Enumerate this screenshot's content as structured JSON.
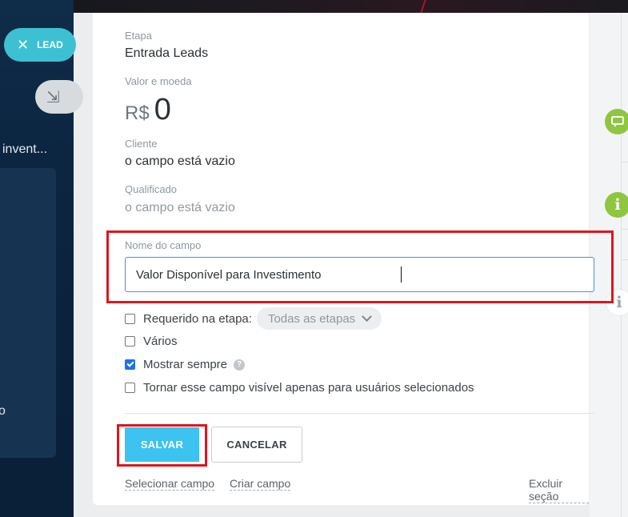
{
  "background": {
    "lead_pill_label": "LEAD",
    "lead_pill_close": "✕",
    "arrow_glyph": "⇲",
    "sidebar_text": "invent...",
    "sidebar_letter": "o"
  },
  "form": {
    "stage_label": "Etapa",
    "stage_value": "Entrada Leads",
    "value_label": "Valor e moeda",
    "currency_symbol": "R$",
    "value_amount": "0",
    "client_label": "Cliente",
    "client_value": "o campo está vazio",
    "qualified_label": "Qualificado",
    "qualified_value": "o campo está vazio",
    "field_name_label": "Nome do campo",
    "field_name_value": "Valor Disponível para Investimento",
    "options": {
      "required_label": "Requerido na etapa:",
      "required_checked": false,
      "stage_select_value": "Todas as etapas",
      "multiple_label": "Vários",
      "multiple_checked": false,
      "always_show_label": "Mostrar sempre",
      "always_show_checked": true,
      "help_glyph": "?",
      "visible_selected_label": "Tornar esse campo visível apenas para usuários selecionados",
      "visible_selected_checked": false
    },
    "buttons": {
      "save": "SALVAR",
      "cancel": "CANCELAR"
    },
    "links": {
      "select_field": "Selecionar campo",
      "create_field": "Criar campo",
      "delete_section": "Excluir seção"
    }
  },
  "right_icons": {
    "info_glyph": "i"
  },
  "colors": {
    "accent": "#3cc3ef",
    "lead_pill": "#3ec0d3",
    "highlight": "#e0141d",
    "green_icon": "#8ec63f",
    "checkbox_checked": "#1a73e8"
  }
}
